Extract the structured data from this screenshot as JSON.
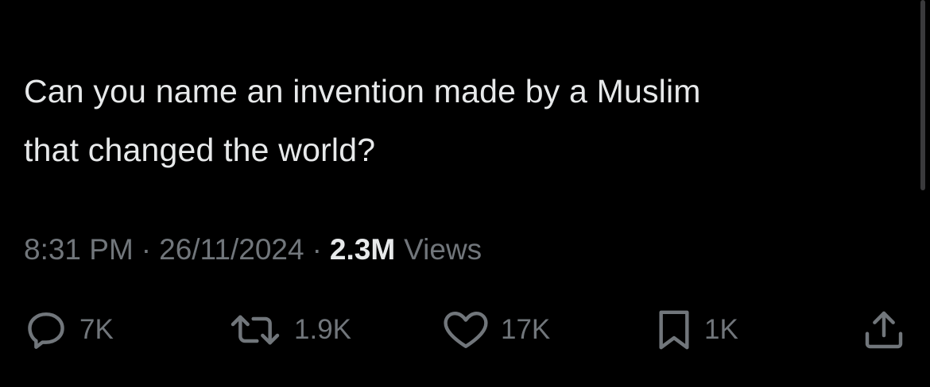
{
  "tweet": {
    "text": "Can you name an invention made by a Muslim\nthat changed the world?",
    "time": "8:31 PM",
    "separator": "·",
    "date": "26/11/2024",
    "views_count": "2.3M",
    "views_label": "Views"
  },
  "actions": {
    "reply": {
      "icon": "reply-icon",
      "count": "7K"
    },
    "repost": {
      "icon": "repost-icon",
      "count": "1.9K"
    },
    "like": {
      "icon": "heart-icon",
      "count": "17K"
    },
    "bookmark": {
      "icon": "bookmark-icon",
      "count": "1K"
    },
    "share": {
      "icon": "share-icon"
    }
  },
  "colors": {
    "background": "#000000",
    "text_primary": "#e7e9ea",
    "text_secondary": "#71767b"
  }
}
